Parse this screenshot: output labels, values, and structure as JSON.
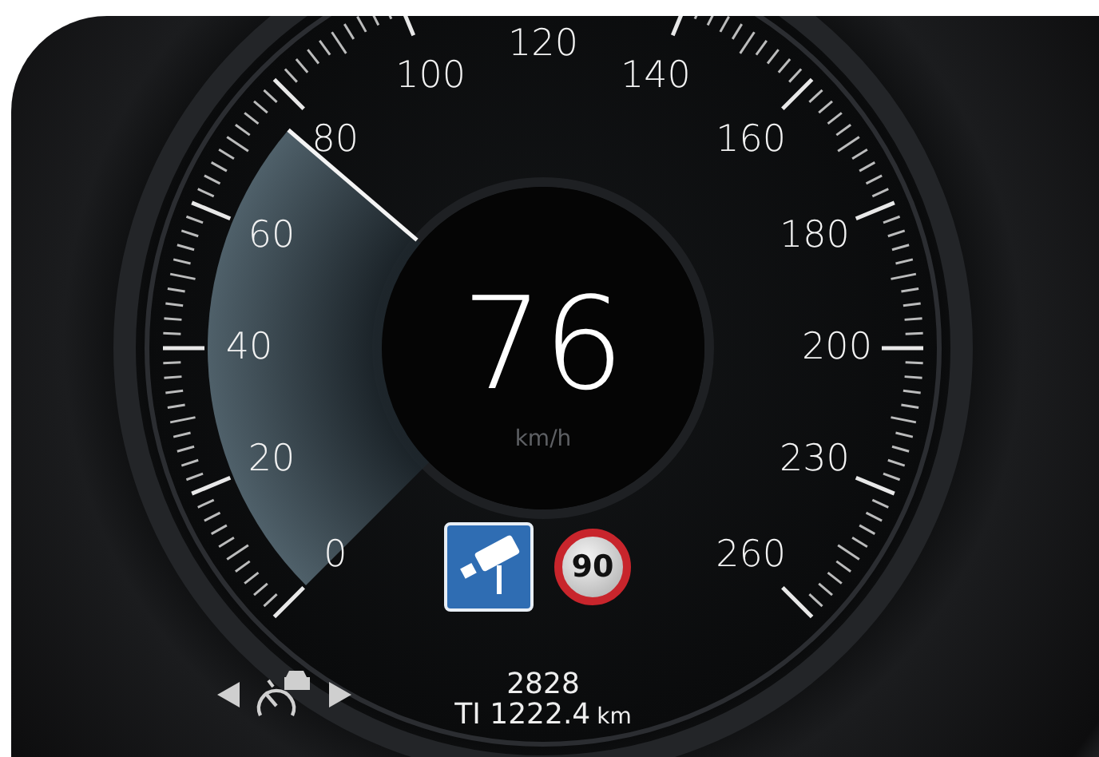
{
  "gauge": {
    "scale_labels": [
      "0",
      "20",
      "40",
      "60",
      "80",
      "100",
      "120",
      "140",
      "160",
      "180",
      "200",
      "230",
      "260"
    ],
    "needle": {
      "level": 0.317
    },
    "speed": "76",
    "unit": "km/h"
  },
  "signs": [
    {
      "kind": "camera"
    },
    {
      "kind": "speed_limit",
      "text": "90"
    }
  ],
  "trip": {
    "odometer": "2828",
    "reading": "TI 1222.4",
    "unit": "km"
  }
}
